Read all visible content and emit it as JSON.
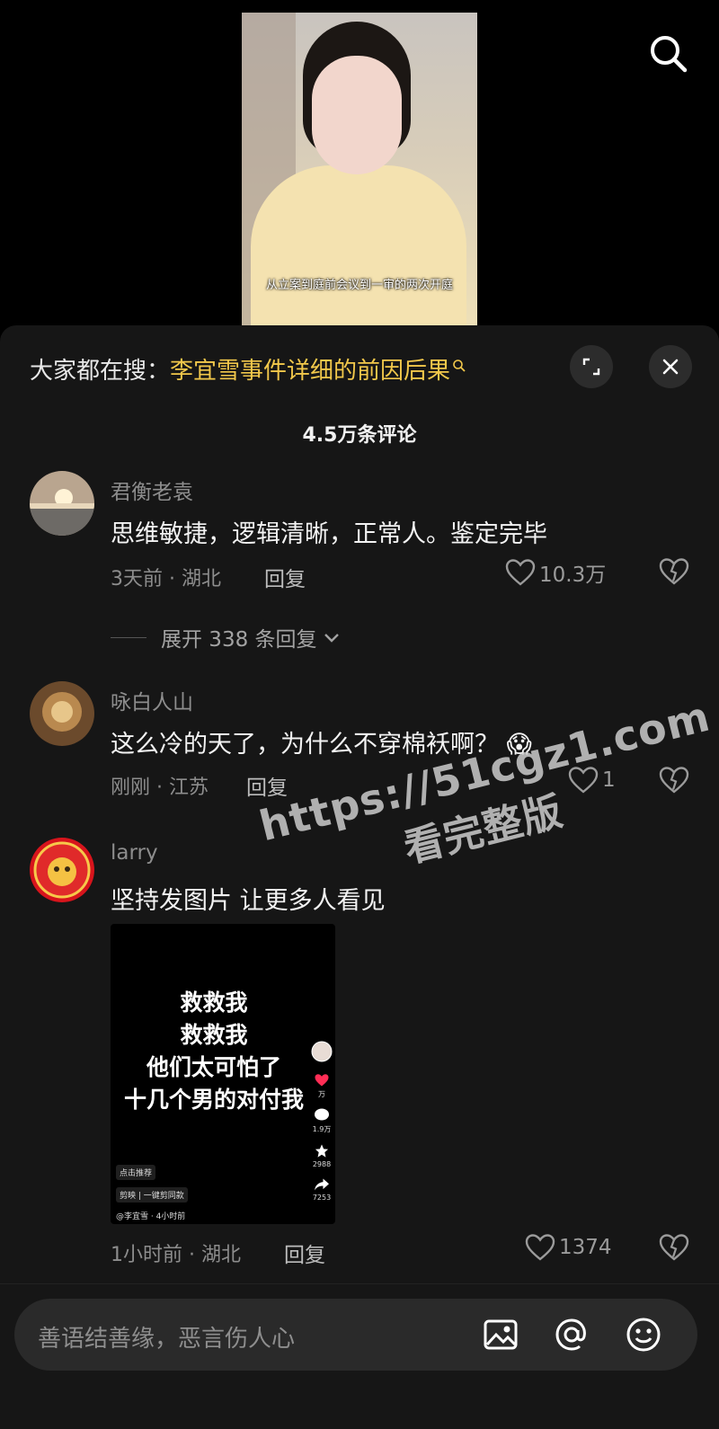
{
  "video": {
    "caption": "从立案到庭前会议到一审的两次开庭"
  },
  "panel": {
    "suggest_prefix": "大家都在搜：",
    "suggest_term": "李宜雪事件详细的前因后果",
    "comment_count": "4.5万条评论"
  },
  "comments": [
    {
      "name": "君衡老袁",
      "text": "思维敏捷，逻辑清晰，正常人。鉴定完毕",
      "time": "3天前 · 湖北",
      "reply": "回复",
      "likes": "10.3万",
      "expand": "展开 338 条回复"
    },
    {
      "name": "咏白人山",
      "text": "这么冷的天了，为什么不穿棉袄啊？",
      "emoji": "😱",
      "time": "刚刚 · 江苏",
      "reply": "回复",
      "likes": "1"
    },
    {
      "name": "larry",
      "text": "坚持发图片 让更多人看见",
      "time": "1小时前 · 湖北",
      "reply": "回复",
      "likes": "1374",
      "image": {
        "lines": [
          "救救我",
          "救救我",
          "他们太可怕了",
          "十几个男的对付我"
        ],
        "rail": [
          "万",
          "1.9万",
          "2988",
          "7253"
        ],
        "tags": [
          "点击推荐",
          "剪映 | 一键剪同款",
          "@李宜雪 · 4小时前"
        ]
      }
    }
  ],
  "watermark": {
    "line1": "https://51cgz1.com",
    "line2": "看完整版"
  },
  "input": {
    "placeholder": "善语结善缘，恶言伤人心"
  },
  "icons": {
    "search": "search-icon",
    "expand": "expand-icon",
    "close": "close-icon",
    "like": "heart-icon",
    "dislike": "broken-heart-icon",
    "image": "image-icon",
    "mention": "at-icon",
    "emoji": "emoji-icon"
  }
}
